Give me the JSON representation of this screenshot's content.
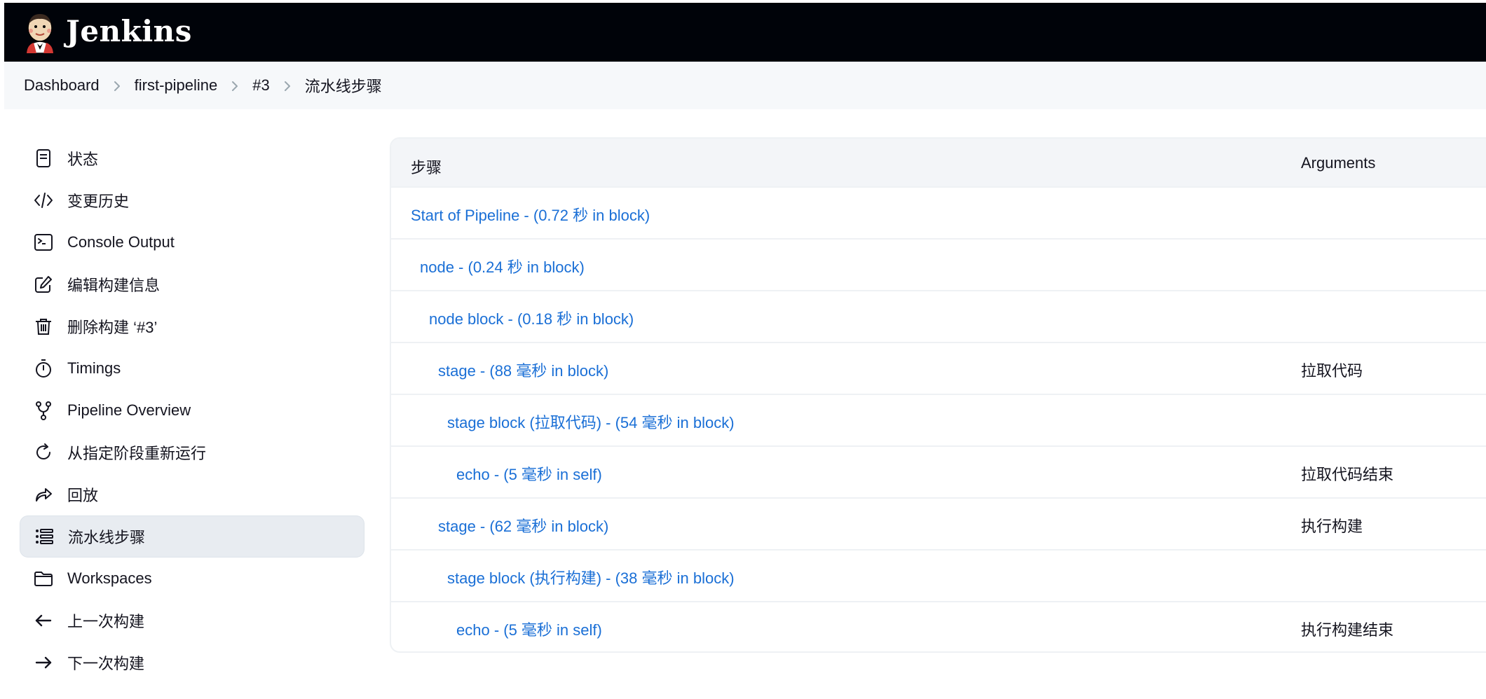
{
  "header": {
    "brand": "Jenkins",
    "logo_icon": "jenkins-butler-logo"
  },
  "breadcrumbs": [
    "Dashboard",
    "first-pipeline",
    "#3",
    "流水线步骤"
  ],
  "sidebar": {
    "items": [
      {
        "label": "状态",
        "icon": "document-icon"
      },
      {
        "label": "变更历史",
        "icon": "code-icon"
      },
      {
        "label": "Console Output",
        "icon": "terminal-icon"
      },
      {
        "label": "编辑构建信息",
        "icon": "edit-icon"
      },
      {
        "label": "删除构建 ‘#3’",
        "icon": "trash-icon"
      },
      {
        "label": "Timings",
        "icon": "stopwatch-icon"
      },
      {
        "label": "Pipeline Overview",
        "icon": "branch-icon"
      },
      {
        "label": "从指定阶段重新运行",
        "icon": "rerun-icon"
      },
      {
        "label": "回放",
        "icon": "replay-icon"
      },
      {
        "label": "流水线步骤",
        "icon": "list-steps-icon",
        "active": true
      },
      {
        "label": "Workspaces",
        "icon": "folder-icon"
      },
      {
        "label": "上一次构建",
        "icon": "arrow-left-icon"
      },
      {
        "label": "下一次构建",
        "icon": "arrow-right-icon"
      }
    ]
  },
  "table": {
    "headers": {
      "step": "步骤",
      "arguments": "Arguments"
    },
    "rows": [
      {
        "step": "Start of Pipeline - (0.72 秒 in block)",
        "indent": 0,
        "arguments": ""
      },
      {
        "step": "node - (0.24 秒 in block)",
        "indent": 1,
        "arguments": ""
      },
      {
        "step": "node block - (0.18 秒 in block)",
        "indent": 2,
        "arguments": ""
      },
      {
        "step": "stage - (88 毫秒 in block)",
        "indent": 3,
        "arguments": "拉取代码"
      },
      {
        "step": "stage block (拉取代码) - (54 毫秒 in block)",
        "indent": 4,
        "arguments": ""
      },
      {
        "step": "echo - (5 毫秒 in self)",
        "indent": 5,
        "arguments": "拉取代码结束"
      },
      {
        "step": "stage - (62 毫秒 in block)",
        "indent": 3,
        "arguments": "执行构建"
      },
      {
        "step": "stage block (执行构建) - (38 毫秒 in block)",
        "indent": 4,
        "arguments": ""
      },
      {
        "step": "echo - (5 毫秒 in self)",
        "indent": 5,
        "arguments": "执行构建结束"
      }
    ]
  },
  "colors": {
    "header_bg": "#000309",
    "link": "#1a6fd6",
    "active_bg": "#e8ecf1"
  }
}
